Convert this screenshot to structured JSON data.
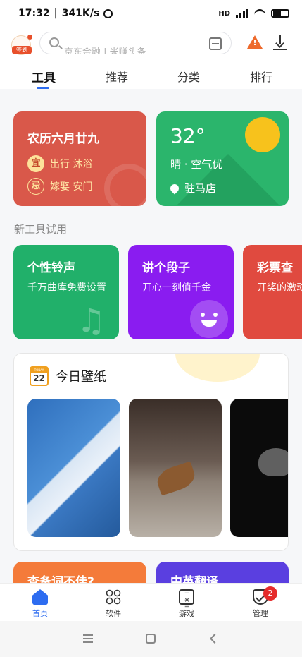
{
  "status_bar": {
    "time": "17:32",
    "speed": "341K/s",
    "network": "HD",
    "icons": [
      "alarm-icon",
      "signal-icon",
      "wifi-icon",
      "battery-icon"
    ]
  },
  "header": {
    "logo_badge": "签到",
    "search_placeholder": "京东金融 | 米赚头条",
    "icons": [
      "scan-icon",
      "warning-icon",
      "download-icon"
    ]
  },
  "tabs": [
    {
      "label": "工具",
      "active": true
    },
    {
      "label": "推荐",
      "active": false
    },
    {
      "label": "分类",
      "active": false
    },
    {
      "label": "排行",
      "active": false
    }
  ],
  "calendar_card": {
    "title": "农历六月廿九",
    "good_badge": "宜",
    "good_text": "出行 沐浴",
    "bad_badge": "忌",
    "bad_text": "嫁娶 安门"
  },
  "weather_card": {
    "temperature": "32°",
    "description": "晴 · 空气优",
    "location": "驻马店"
  },
  "new_tools": {
    "section_title": "新工具试用",
    "items": [
      {
        "title": "个性铃声",
        "desc": "千万曲库免费设置",
        "color": "#21b06a",
        "icon": "music-note-icon"
      },
      {
        "title": "讲个段子",
        "desc": "开心一刻值千金",
        "color": "#8a1cf0",
        "icon": "smile-icon"
      },
      {
        "title": "彩票查",
        "desc": "开奖的激动啊",
        "color": "#e04a3f",
        "icon": ""
      }
    ]
  },
  "wallpaper": {
    "calendar_top": "TODAY",
    "day_number": "22",
    "title": "今日壁纸",
    "images": [
      "building-wallpaper",
      "autumn-leaf-wallpaper",
      "jellyfish-wallpaper"
    ]
  },
  "peek_cards": [
    {
      "title": "查备词不佳?",
      "color": "#f47b3a"
    },
    {
      "title": "中英翻译",
      "color": "#5a3fe0"
    }
  ],
  "bottom_nav": [
    {
      "label": "首页",
      "icon": "home-icon",
      "active": true
    },
    {
      "label": "软件",
      "icon": "apps-icon",
      "active": false
    },
    {
      "label": "游戏",
      "icon": "game-icon",
      "active": false
    },
    {
      "label": "管理",
      "icon": "shield-icon",
      "active": false,
      "badge": "2"
    }
  ],
  "colors": {
    "accent": "#2d6cf0",
    "calendar_bg": "#d9584a",
    "weather_bg": "#2bb56c"
  }
}
